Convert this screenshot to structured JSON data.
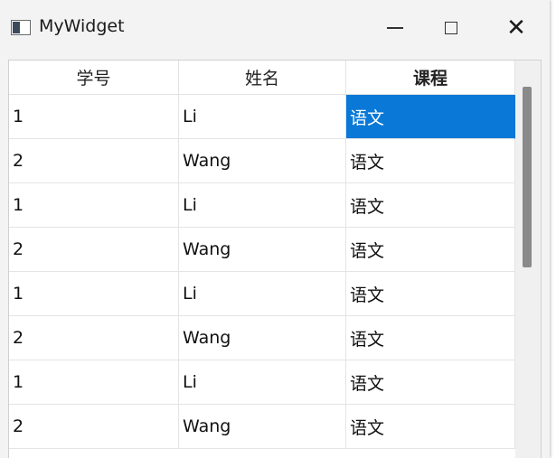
{
  "window": {
    "title": "MyWidget",
    "icons": {
      "app": "app-window-icon",
      "minimize": "minimize-icon",
      "maximize": "maximize-icon",
      "close": "close-icon"
    },
    "close_glyph": "✕"
  },
  "table": {
    "headers": [
      "学号",
      "姓名",
      "课程"
    ],
    "sorted_column": "课程",
    "selected_cell": {
      "row": 0,
      "column": 2
    },
    "rows": [
      [
        "1",
        "Li",
        "语文"
      ],
      [
        "2",
        "Wang",
        "语文"
      ],
      [
        "1",
        "Li",
        "语文"
      ],
      [
        "2",
        "Wang",
        "语文"
      ],
      [
        "1",
        "Li",
        "语文"
      ],
      [
        "2",
        "Wang",
        "语文"
      ],
      [
        "1",
        "Li",
        "语文"
      ],
      [
        "2",
        "Wang",
        "语文"
      ]
    ]
  },
  "colors": {
    "selection": "#0a78d7",
    "window_bg": "#f3f3f3",
    "scroll_thumb": "#8a8a8a"
  }
}
